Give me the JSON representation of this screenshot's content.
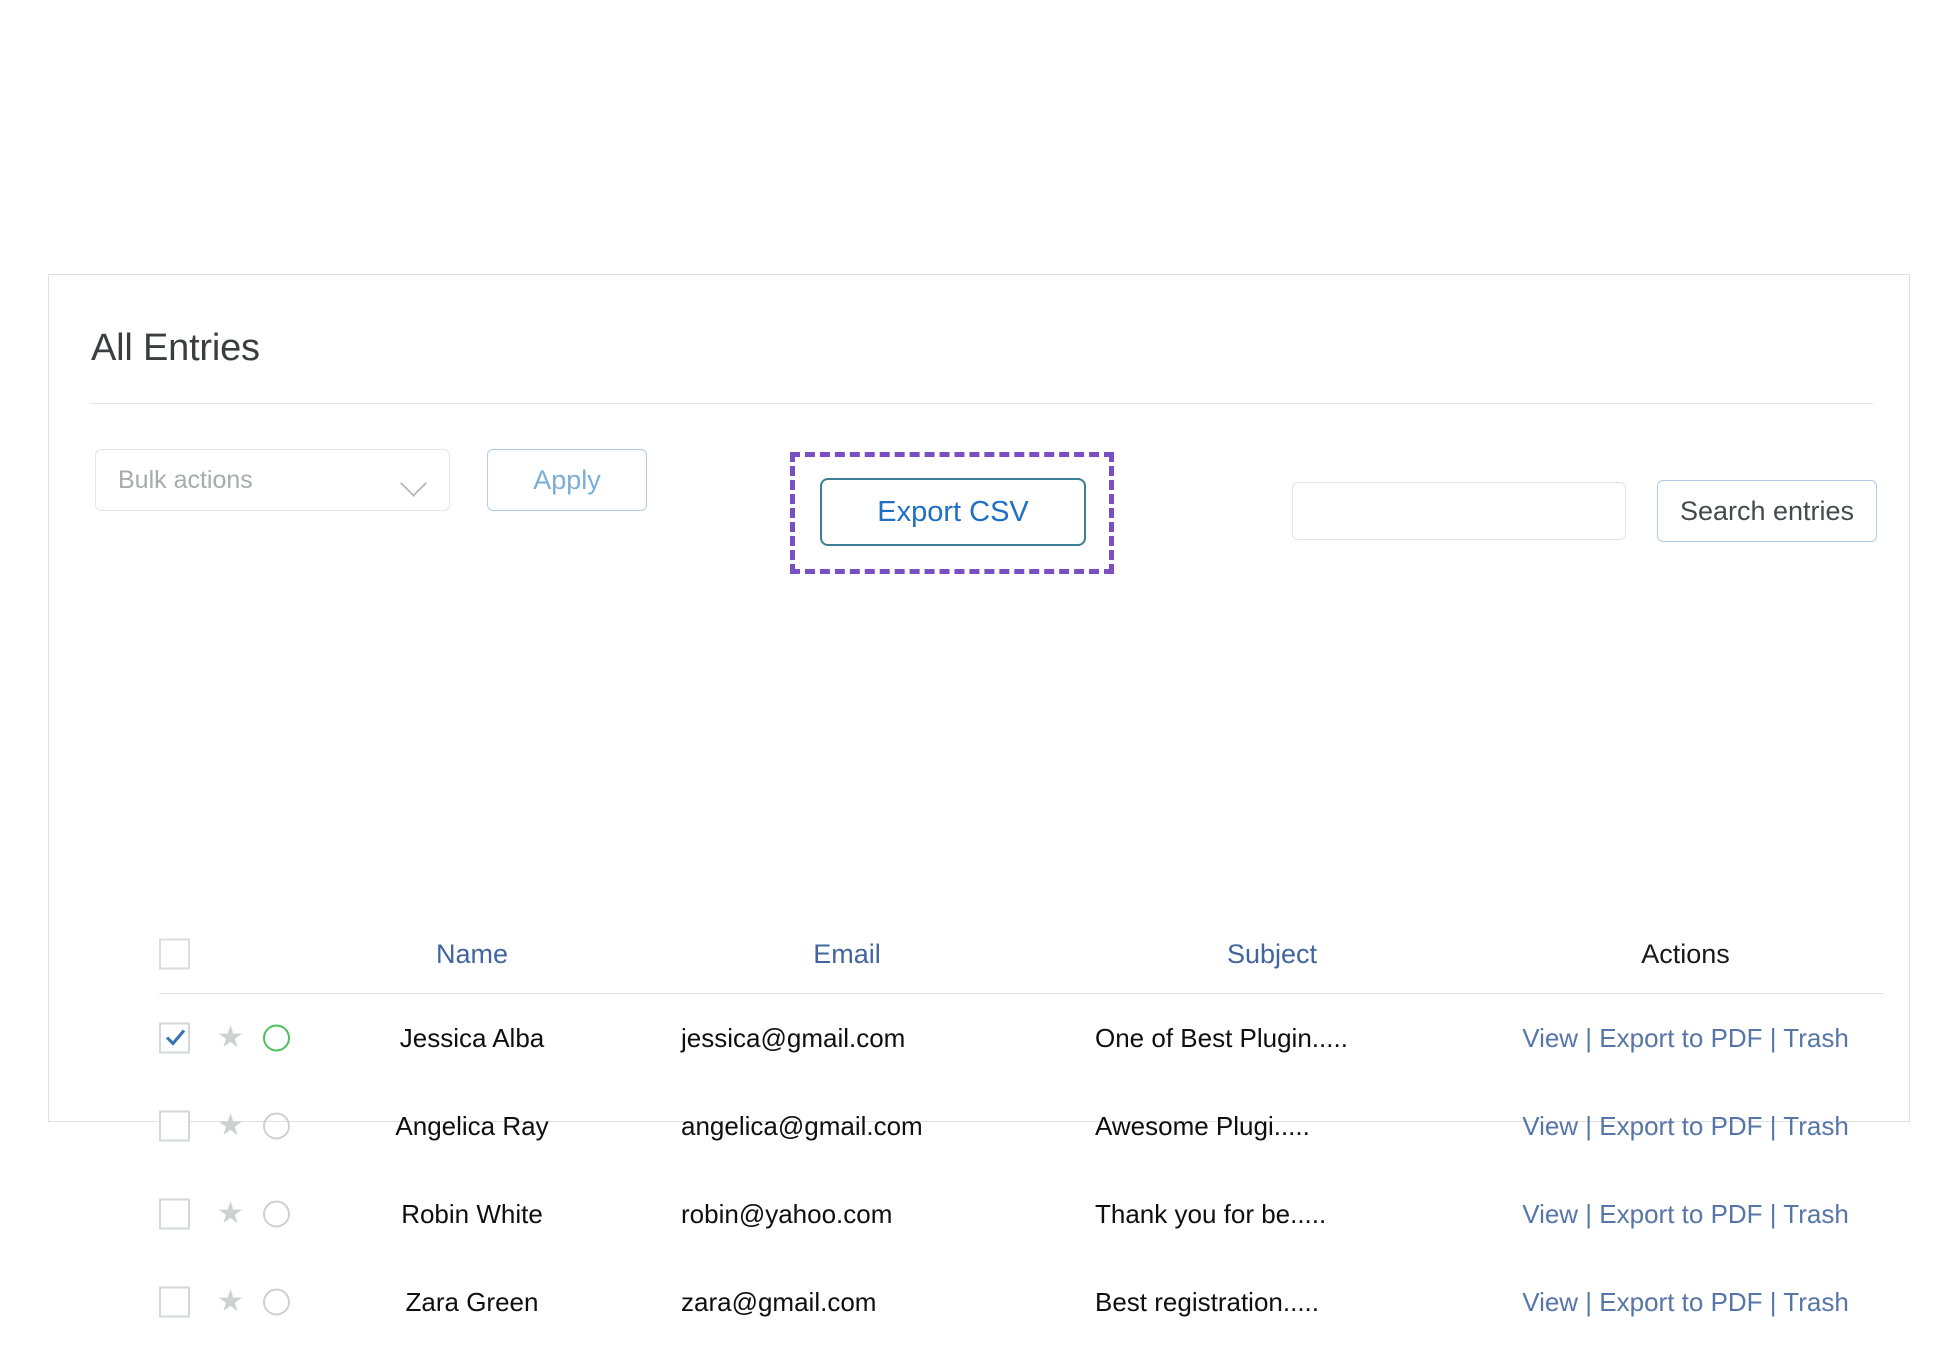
{
  "card": {
    "title": "All Entries"
  },
  "toolbar": {
    "bulk_placeholder": "Bulk actions",
    "bulk_selected": "",
    "apply_label": "Apply",
    "export_label": "Export CSV",
    "search_value": "",
    "search_placeholder": "",
    "search_button_label": "Search entries",
    "highlight_color": "#7b4fc4",
    "accent_link_color": "#1f6fc4",
    "apply_text_color": "#7aafd9"
  },
  "table": {
    "headers": {
      "select_all": "",
      "name": "Name",
      "email": "Email",
      "subject": "Subject",
      "actions": "Actions"
    },
    "header_link_color": "#41659e",
    "actions_text": "View | Export to PDF | Trash",
    "rows": [
      {
        "checked": true,
        "star": "★",
        "star_color": "#cfd0d2",
        "circle_color": "#4cc15f",
        "name": "Jessica Alba",
        "email": "jessica@gmail.com",
        "subject": "One of Best Plugin.....",
        "actions": "View | Export to PDF | Trash"
      },
      {
        "checked": false,
        "star": "★",
        "star_color": "#cfd0d2",
        "circle_color": "#cfd0d2",
        "name": "Angelica Ray",
        "email": "angelica@gmail.com",
        "subject": "Awesome Plugi.....",
        "actions": "View | Export to PDF | Trash"
      },
      {
        "checked": false,
        "star": "★",
        "star_color": "#cfd0d2",
        "circle_color": "#cfd0d2",
        "name": "Robin White",
        "email": "robin@yahoo.com",
        "subject": " Thank you for be.....",
        "actions": "View | Export to PDF | Trash"
      },
      {
        "checked": false,
        "star": "★",
        "star_color": "#cfd0d2",
        "circle_color": "#cfd0d2",
        "name": "Zara Green",
        "email": "zara@gmail.com",
        "subject": "Best registration.....",
        "actions": "View | Export to PDF | Trash"
      }
    ]
  }
}
